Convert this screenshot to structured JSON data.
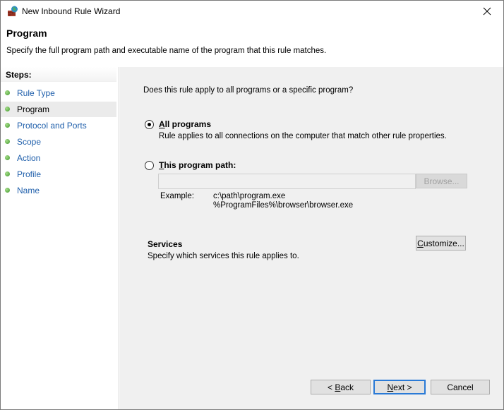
{
  "window": {
    "title": "New Inbound Rule Wizard",
    "close_label": "Close"
  },
  "header": {
    "title": "Program",
    "description": "Specify the full program path and executable name of the program that this rule matches."
  },
  "sidebar": {
    "steps_label": "Steps:",
    "items": [
      {
        "label": "Rule Type",
        "current": false
      },
      {
        "label": "Program",
        "current": true
      },
      {
        "label": "Protocol and Ports",
        "current": false
      },
      {
        "label": "Scope",
        "current": false
      },
      {
        "label": "Action",
        "current": false
      },
      {
        "label": "Profile",
        "current": false
      },
      {
        "label": "Name",
        "current": false
      }
    ]
  },
  "main": {
    "question": "Does this rule apply to all programs or a specific program?",
    "options": [
      {
        "label_accel": "A",
        "label_rest": "ll programs",
        "selected": true,
        "description": "Rule applies to all connections on the computer that match other rule properties."
      },
      {
        "label_accel": "T",
        "label_rest": "his program path:",
        "selected": false
      }
    ],
    "program_path": {
      "value": "",
      "placeholder": "",
      "enabled": false
    },
    "browse_label": "Browse...",
    "example_label": "Example:",
    "examples": [
      "c:\\path\\program.exe",
      "%ProgramFiles%\\browser\\browser.exe"
    ],
    "services": {
      "title": "Services",
      "description": "Specify which services this rule applies to.",
      "customize_accel": "C",
      "customize_rest": "ustomize..."
    }
  },
  "footer": {
    "back_prefix": "< ",
    "back_accel": "B",
    "back_rest": "ack",
    "next_accel": "N",
    "next_rest": "ext >",
    "cancel_label": "Cancel"
  },
  "colors": {
    "link": "#1f5fab",
    "step_dot": "#3f9a2b",
    "panel_bg": "#f0f0f0",
    "default_button_border": "#2a7ad6"
  }
}
